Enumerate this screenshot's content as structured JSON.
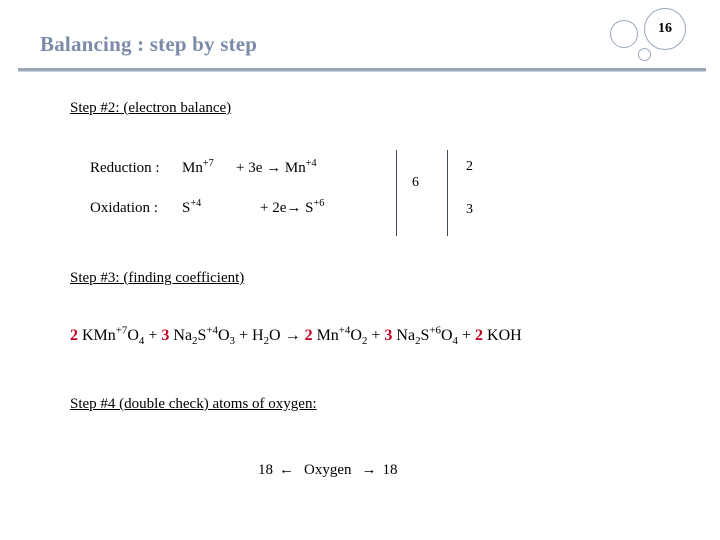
{
  "slide": {
    "title": "Balancing : step by step",
    "number": "16",
    "accent_color": "#7b8ba8",
    "coefficient_color": "#c00020",
    "rule_color": "#9aa8b8"
  },
  "step2": {
    "heading": "Step #2: (electron balance)",
    "reduction": {
      "label": "Reduction :",
      "reactant": "Mn",
      "reactant_charge": "+7",
      "electrons": "+ 3e",
      "arrow": "→",
      "product": "Mn",
      "product_charge": "+4",
      "factor": "2"
    },
    "oxidation": {
      "label": "Oxidation :",
      "reactant": "S",
      "reactant_charge": "+4",
      "electrons": "+ 2e",
      "arrow": "→",
      "product": "S",
      "product_charge": "+6",
      "factor": "3"
    },
    "lcm": "6"
  },
  "step3": {
    "heading": "Step #3: (finding coefficient)",
    "equation": {
      "arrow": "→",
      "plus": "+",
      "terms": [
        {
          "coefficient": "2",
          "formula": "KMn",
          "charge": "+7",
          "tail": "O",
          "tail_sub": "4"
        },
        {
          "coefficient": "3",
          "formula": "Na",
          "formula_sub": "2",
          "formula2": "S",
          "charge": "+4",
          "tail": "O",
          "tail_sub": "3"
        },
        {
          "coefficient": "",
          "formula": "H",
          "formula_sub": "2",
          "tail": "O"
        },
        {
          "coefficient": "2",
          "formula": "Mn",
          "charge": "+4",
          "tail": "O",
          "tail_sub": "2"
        },
        {
          "coefficient": "3",
          "formula": "Na",
          "formula_sub": "2",
          "formula2": "S",
          "charge": "+6",
          "tail": "O",
          "tail_sub": "4"
        },
        {
          "coefficient": "2",
          "formula": "KOH"
        }
      ]
    }
  },
  "step4": {
    "heading": "Step #4  (double check) atoms of oxygen:",
    "oxygen_left_count": "18",
    "left_arrow": "←",
    "oxygen_label": "Oxygen",
    "right_arrow": "→",
    "oxygen_right_count": "18"
  }
}
